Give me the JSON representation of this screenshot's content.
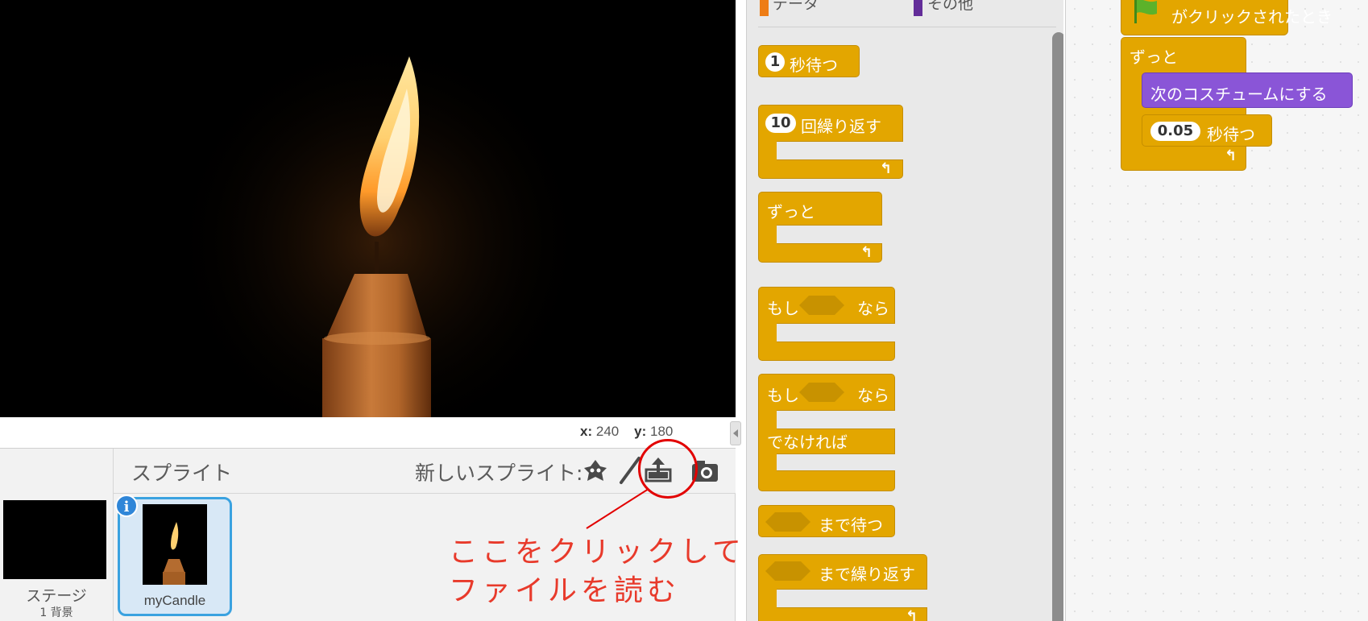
{
  "stage": {
    "coords_x_label": "x:",
    "coords_x": "240",
    "coords_y_label": "y:",
    "coords_y": "180"
  },
  "sprites_pane": {
    "title": "スプライト",
    "new_sprite_label": "新しいスプライト:",
    "tools": [
      "sprite-library-icon",
      "paint-brush-icon",
      "upload-icon",
      "camera-icon"
    ],
    "stage_thumb_label": "ステージ",
    "stage_thumb_sub": "1 背景",
    "sprite_name": "myCandle",
    "info_badge": "i"
  },
  "annotation": {
    "line1": "ここをクリックして",
    "line2": "ファイルを読む",
    "color": "#e20000"
  },
  "palette": {
    "categories": [
      {
        "label": "データ",
        "color": "#ee7d16"
      },
      {
        "label": "その他",
        "color": "#632d99"
      }
    ],
    "blocks": {
      "wait": {
        "value": "1",
        "label": "秒待つ"
      },
      "repeat": {
        "value": "10",
        "label": "回繰り返す"
      },
      "forever": {
        "label": "ずっと"
      },
      "if": {
        "label1": "もし",
        "label2": "なら"
      },
      "ifelse": {
        "label1": "もし",
        "label2": "なら",
        "else": "でなければ"
      },
      "wait_until": {
        "label": "まで待つ"
      },
      "repeat_until": {
        "label": "まで繰り返す"
      }
    },
    "colors": {
      "control": "#e3a600",
      "looks": "#8a55d7"
    }
  },
  "script": {
    "hat_label": "がクリックされたとき",
    "forever_label": "ずっと",
    "next_costume": "次のコスチュームにする",
    "wait_value": "0.05",
    "wait_label": "秒待つ"
  }
}
